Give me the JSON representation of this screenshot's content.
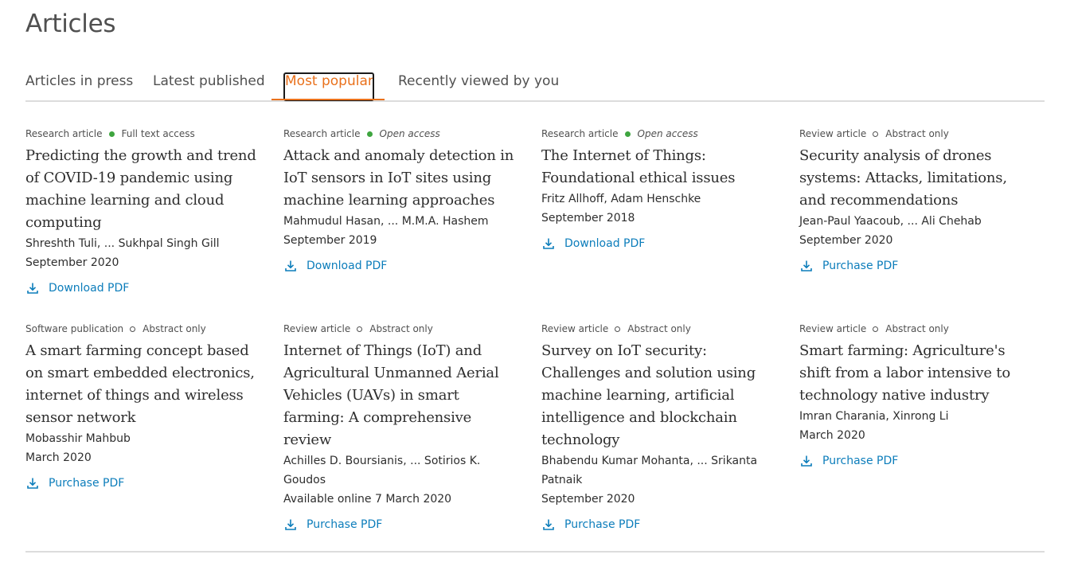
{
  "header": {
    "title": "Articles"
  },
  "tabs": [
    {
      "label": "Articles in press"
    },
    {
      "label": "Latest published"
    },
    {
      "label": "Most popular",
      "active": true
    },
    {
      "label": "Recently viewed by you"
    }
  ],
  "colors": {
    "accent": "#e9711c",
    "link": "#0c7dbb",
    "open_dot": "#3ea53f"
  },
  "articles": [
    {
      "type": "Research article",
      "access": "Full text access",
      "access_icon": "filled-dot",
      "title": "Predicting the growth and trend of COVID-19 pandemic using machine learning and cloud computing",
      "authors": "Shreshth Tuli, ... Sukhpal Singh Gill",
      "date": "September 2020",
      "pdf_label": "Download PDF"
    },
    {
      "type": "Research article",
      "access": "Open access",
      "access_icon": "filled-dot",
      "title": "Attack and anomaly detection in IoT sensors in IoT sites using machine learning approaches",
      "authors": "Mahmudul Hasan, ... M.M.A. Hashem",
      "date": "September 2019",
      "pdf_label": "Download PDF"
    },
    {
      "type": "Research article",
      "access": "Open access",
      "access_icon": "filled-dot",
      "title": "The Internet of Things: Foundational ethical issues",
      "authors": "Fritz Allhoff, Adam Henschke",
      "date": "September 2018",
      "pdf_label": "Download PDF"
    },
    {
      "type": "Review article",
      "access": "Abstract only",
      "access_icon": "hollow-dot",
      "title": "Security analysis of drones systems: Attacks, limitations, and recommendations",
      "authors": "Jean-Paul Yaacoub, ... Ali Chehab",
      "date": "September 2020",
      "pdf_label": "Purchase PDF"
    },
    {
      "type": "Software publication",
      "access": "Abstract only",
      "access_icon": "hollow-dot",
      "title": "A smart farming concept based on smart embedded electronics, internet of things and wireless sensor network",
      "authors": "Mobasshir Mahbub",
      "date": "March 2020",
      "pdf_label": "Purchase PDF"
    },
    {
      "type": "Review article",
      "access": "Abstract only",
      "access_icon": "hollow-dot",
      "title": "Internet of Things (IoT) and Agricultural Unmanned Aerial Vehicles (UAVs) in smart farming: A comprehensive review",
      "authors": "Achilles D. Boursianis, ... Sotirios K. Goudos",
      "date": "Available online 7 March 2020",
      "pdf_label": "Purchase PDF"
    },
    {
      "type": "Review article",
      "access": "Abstract only",
      "access_icon": "hollow-dot",
      "title": "Survey on IoT security: Challenges and solution using machine learning, artificial intelligence and blockchain technology",
      "authors": "Bhabendu Kumar Mohanta, ... Srikanta Patnaik",
      "date": "September 2020",
      "pdf_label": "Purchase PDF"
    },
    {
      "type": "Review article",
      "access": "Abstract only",
      "access_icon": "hollow-dot",
      "title": "Smart farming: Agriculture's shift from a labor intensive to technology native industry",
      "authors": "Imran Charania, Xinrong Li",
      "date": "March 2020",
      "pdf_label": "Purchase PDF"
    }
  ]
}
